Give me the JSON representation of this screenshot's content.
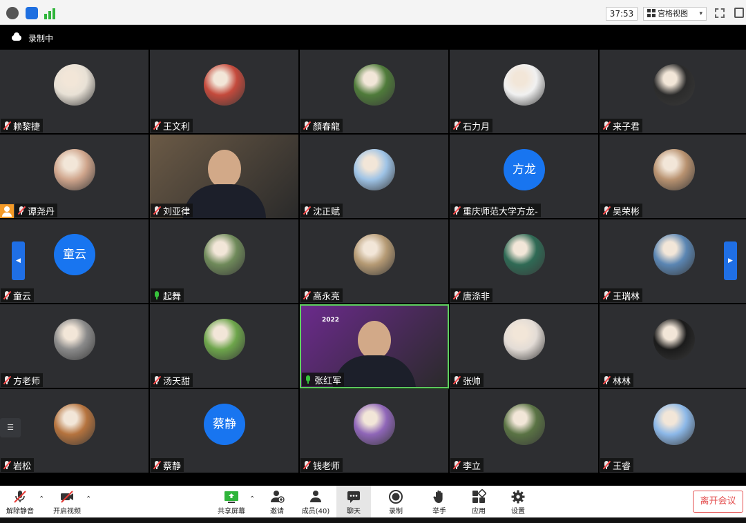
{
  "topbar": {
    "timer": "37:53",
    "view_label": "宫格视图",
    "view_caret": "▾"
  },
  "recording": {
    "label": "录制中"
  },
  "participants": [
    {
      "name": "赖黎捷",
      "mic": "muted",
      "avatar": "photo",
      "color": "#e8e1d6"
    },
    {
      "name": "王文利",
      "mic": "muted",
      "avatar": "photo",
      "color": "#c44a3c"
    },
    {
      "name": "顏春龍",
      "mic": "muted",
      "avatar": "photo",
      "color": "#4f7b3a"
    },
    {
      "name": "石力月",
      "mic": "muted",
      "avatar": "photo",
      "color": "#f1f1f1"
    },
    {
      "name": "来子君",
      "mic": "muted",
      "avatar": "photo",
      "color": "#2b2b2b"
    },
    {
      "name": "谭尧丹",
      "mic": "muted",
      "avatar": "photo",
      "color": "#cfa58c",
      "host": true
    },
    {
      "name": "刘亚律",
      "mic": "muted",
      "avatar": "video",
      "color": "#6b5a46"
    },
    {
      "name": "沈正赋",
      "mic": "muted",
      "avatar": "photo",
      "color": "#9ec3e6"
    },
    {
      "name": "重庆师范大学方龙-",
      "mic": "muted",
      "avatar": "initials",
      "initials": "方龙",
      "color": "#1875f0"
    },
    {
      "name": "吴荣彬",
      "mic": "muted",
      "avatar": "photo",
      "color": "#b89270"
    },
    {
      "name": "童云",
      "mic": "muted",
      "avatar": "initials",
      "initials": "童云",
      "color": "#1875f0"
    },
    {
      "name": "起舞",
      "mic": "on",
      "avatar": "photo",
      "color": "#6f8a5a"
    },
    {
      "name": "高永亮",
      "mic": "muted",
      "avatar": "photo",
      "color": "#b59a74"
    },
    {
      "name": "唐涤非",
      "mic": "muted",
      "avatar": "photo",
      "color": "#2f6a55"
    },
    {
      "name": "王瑞林",
      "mic": "muted",
      "avatar": "photo",
      "color": "#5b86b3"
    },
    {
      "name": "方老师",
      "mic": "muted",
      "avatar": "photo",
      "color": "#8a8a8a"
    },
    {
      "name": "汤天甜",
      "mic": "muted",
      "avatar": "photo",
      "color": "#6da54b"
    },
    {
      "name": "张红军",
      "mic": "on",
      "avatar": "video",
      "color": "#6b2a8c",
      "active": true
    },
    {
      "name": "张帅",
      "mic": "muted",
      "avatar": "photo",
      "color": "#e3dcd6"
    },
    {
      "name": "林林",
      "mic": "muted",
      "avatar": "photo",
      "color": "#1b1b1b"
    },
    {
      "name": "岩松",
      "mic": "muted",
      "avatar": "photo",
      "color": "#b5733e"
    },
    {
      "name": "蔡静",
      "mic": "muted",
      "avatar": "initials",
      "initials": "蔡静",
      "color": "#1875f0"
    },
    {
      "name": "钱老师",
      "mic": "muted",
      "avatar": "photo",
      "color": "#8f66b8"
    },
    {
      "name": "李立",
      "mic": "muted",
      "avatar": "photo",
      "color": "#5a7344"
    },
    {
      "name": "王睿",
      "mic": "muted",
      "avatar": "photo",
      "color": "#8cb8e8"
    }
  ],
  "video_banner": {
    "year": "2022"
  },
  "toolbar": {
    "unmute": "解除静音",
    "start_video": "开启视频",
    "share": "共享屏幕",
    "invite": "邀请",
    "members": "成员(40)",
    "chat": "聊天",
    "record": "录制",
    "raise_hand": "举手",
    "apps": "应用",
    "settings": "设置",
    "leave": "离开会议"
  },
  "colors": {
    "accent": "#1875f0",
    "leave": "#e34b4b",
    "tile": "#2d2e31"
  }
}
